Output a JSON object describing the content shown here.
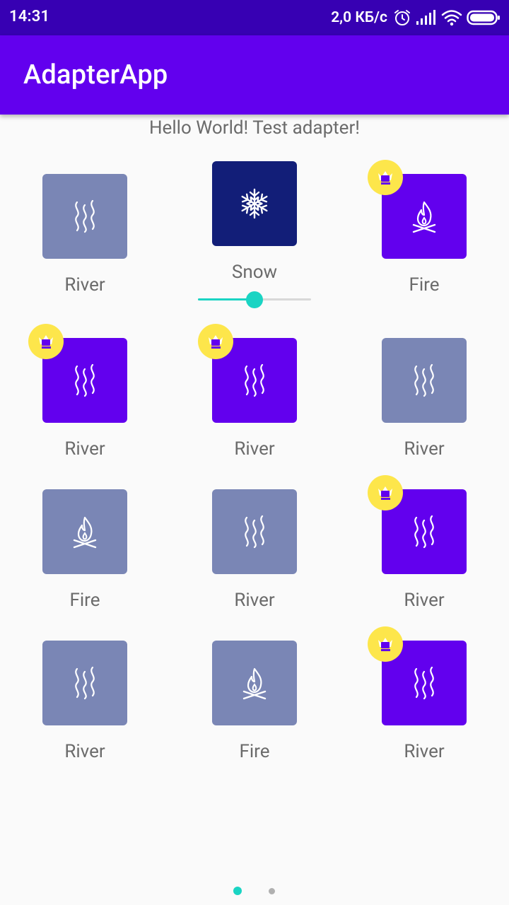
{
  "status_bar": {
    "time": "14:31",
    "speed": "2,0 КБ/с",
    "icons": [
      "alarm-icon",
      "signal-icon",
      "wifi-icon",
      "battery-icon"
    ]
  },
  "app_bar": {
    "title": "AdapterApp"
  },
  "header_text": "Hello World! Test adapter!",
  "colors": {
    "primary": "#6200ee",
    "primary_dark": "#3700b3",
    "tile_normal": "#7a86b5",
    "tile_selected": "#121e78",
    "badge": "#fde64b",
    "accent": "#1ad4c3"
  },
  "grid": {
    "items": [
      {
        "label": "River",
        "icon": "river-icon",
        "style": "normal",
        "premium": false
      },
      {
        "label": "Snow",
        "icon": "snowflake-icon",
        "style": "selected",
        "premium": false,
        "slider_value": 0.5
      },
      {
        "label": "Fire",
        "icon": "fire-icon",
        "style": "premium",
        "premium": true
      },
      {
        "label": "River",
        "icon": "river-icon",
        "style": "premium",
        "premium": true
      },
      {
        "label": "River",
        "icon": "river-icon",
        "style": "premium",
        "premium": true
      },
      {
        "label": "River",
        "icon": "river-icon",
        "style": "normal",
        "premium": false
      },
      {
        "label": "Fire",
        "icon": "fire-icon",
        "style": "normal",
        "premium": false
      },
      {
        "label": "River",
        "icon": "river-icon",
        "style": "normal",
        "premium": false
      },
      {
        "label": "River",
        "icon": "river-icon",
        "style": "premium",
        "premium": true
      },
      {
        "label": "River",
        "icon": "river-icon",
        "style": "normal",
        "premium": false
      },
      {
        "label": "Fire",
        "icon": "fire-icon",
        "style": "normal",
        "premium": false
      },
      {
        "label": "River",
        "icon": "river-icon",
        "style": "premium",
        "premium": true
      }
    ]
  },
  "pager": {
    "page_count": 2,
    "current_page": 1
  }
}
